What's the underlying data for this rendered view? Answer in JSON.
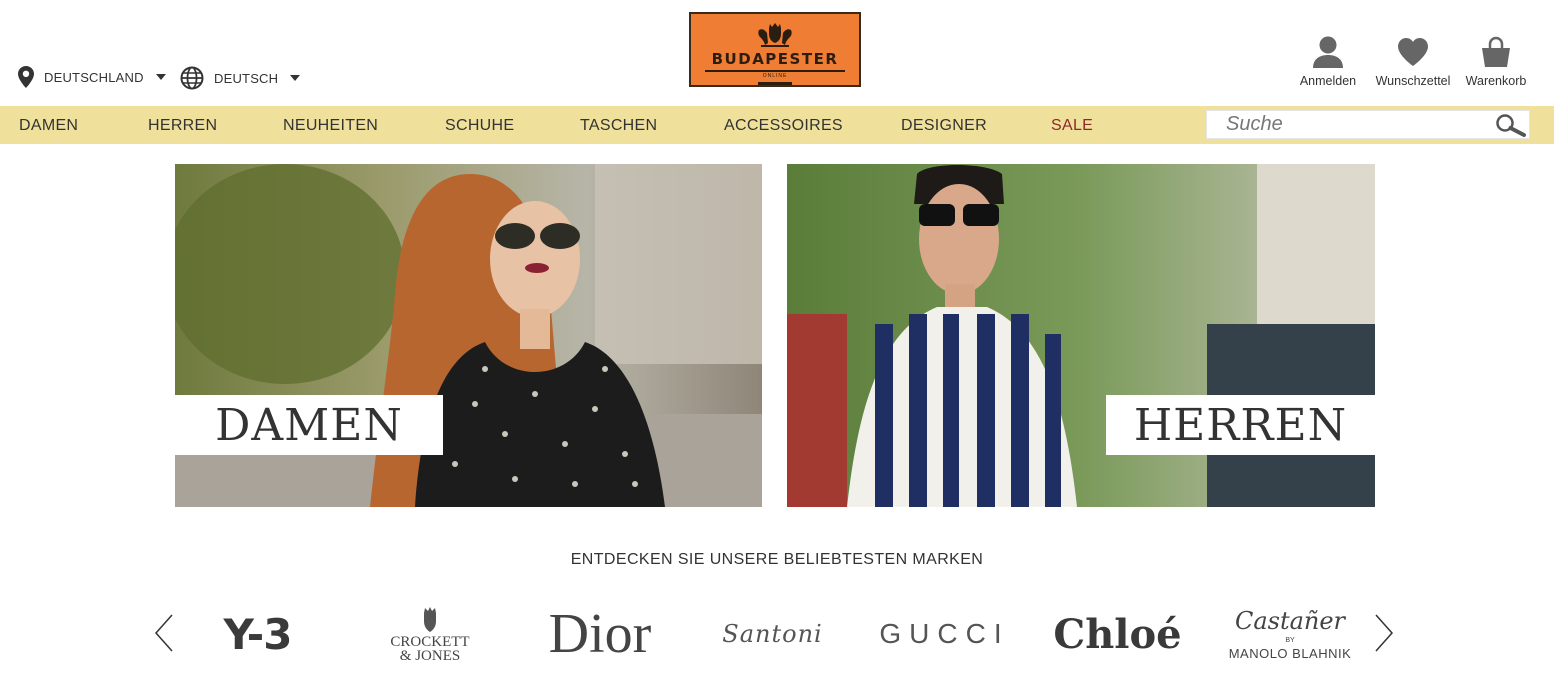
{
  "header": {
    "country": "DEUTSCHLAND",
    "language": "DEUTSCH",
    "logo": {
      "name": "BUDAPESTER",
      "sub": "ONLINE"
    },
    "account": [
      {
        "label": "Anmelden",
        "icon": "user-icon"
      },
      {
        "label": "Wunschzettel",
        "icon": "heart-icon"
      },
      {
        "label": "Warenkorb",
        "icon": "shopping-bag-icon"
      }
    ]
  },
  "nav": {
    "items": [
      "DAMEN",
      "HERREN",
      "NEUHEITEN",
      "SCHUHE",
      "TASCHEN",
      "ACCESSOIRES",
      "DESIGNER",
      "SALE"
    ],
    "search_placeholder": "Suche"
  },
  "hero": {
    "damen_label": "DAMEN",
    "herren_label": "HERREN"
  },
  "brands": {
    "title": "ENTDECKEN SIE UNSERE BELIEBTESTEN MARKEN",
    "items": [
      {
        "name": "Y-3"
      },
      {
        "name": "CROCKETT & JONES",
        "lines": [
          "CROCKETT",
          "& JONES"
        ]
      },
      {
        "name": "Dior"
      },
      {
        "name": "Santoni"
      },
      {
        "name": "GUCCI"
      },
      {
        "name": "Chloé"
      },
      {
        "name": "Castañer by Manolo Blahnik",
        "lines": [
          "Castañer",
          "BY",
          "MANOLO BLAHNIK"
        ]
      }
    ]
  },
  "colors": {
    "nav_bg": "#efe09b",
    "logo_bg": "#ef7d34",
    "sale": "#8b2a2a",
    "text": "#333333"
  }
}
